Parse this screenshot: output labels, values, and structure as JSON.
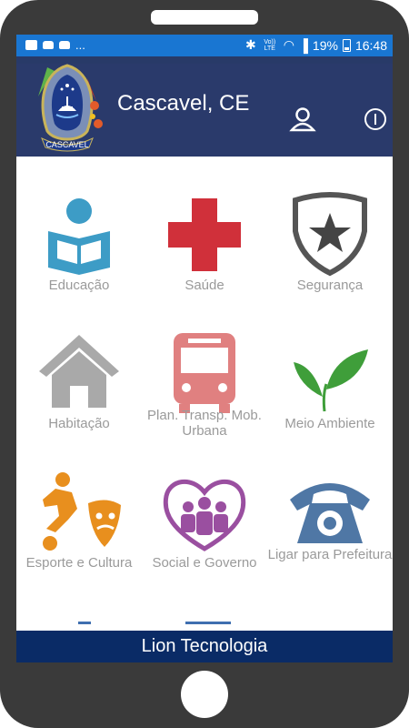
{
  "status_bar": {
    "left_icons": [
      "gallery-icon",
      "car-icon",
      "car-icon"
    ],
    "dots": "...",
    "volte": "Vo)) LTE",
    "battery": "19%",
    "time": "16:48"
  },
  "app": {
    "title": "Cascavel, CE",
    "logo_text": "CASCAVEL",
    "header_color": "#2a3a6b"
  },
  "tiles": [
    {
      "label": "Educação",
      "icon": "reading-person-icon",
      "color": "#3d9cc6"
    },
    {
      "label": "Saúde",
      "icon": "red-cross-icon",
      "color": "#d0303a"
    },
    {
      "label": "Segurança",
      "icon": "police-badge-icon",
      "color": "#555555"
    },
    {
      "label": "Habitação",
      "icon": "house-icon",
      "color": "#a9a9a9"
    },
    {
      "label": "Plan. Transp. Mob. Urbana",
      "icon": "bus-icon",
      "color": "#e08080"
    },
    {
      "label": "Meio Ambiente",
      "icon": "leaves-icon",
      "color": "#3f9e3a"
    },
    {
      "label": "Esporte e Cultura",
      "icon": "sports-culture-icon",
      "color": "#e88f1e"
    },
    {
      "label": "Social e Governo",
      "icon": "community-heart-icon",
      "color": "#9a4fa0"
    },
    {
      "label": "Ligar para Prefeitura",
      "icon": "telephone-icon",
      "color": "#4f77a5"
    }
  ],
  "footer": {
    "text": "Lion Tecnologia",
    "color": "#0a2b66"
  }
}
